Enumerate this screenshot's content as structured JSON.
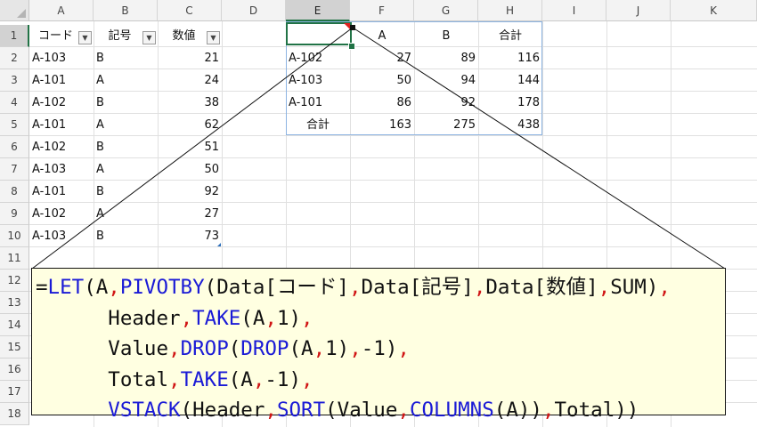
{
  "columns": [
    "A",
    "B",
    "C",
    "D",
    "E",
    "F",
    "G",
    "H",
    "I",
    "J",
    "K"
  ],
  "selected_column": "E",
  "rows": [
    "1",
    "2",
    "3",
    "4",
    "5",
    "6",
    "7",
    "8",
    "9",
    "10",
    "11",
    "12",
    "13",
    "14",
    "15",
    "16",
    "17",
    "18"
  ],
  "selected_row": "1",
  "table": {
    "headers": [
      "コード",
      "記号",
      "数値"
    ],
    "rows": [
      [
        "A-103",
        "B",
        "21"
      ],
      [
        "A-101",
        "A",
        "24"
      ],
      [
        "A-102",
        "B",
        "38"
      ],
      [
        "A-101",
        "A",
        "62"
      ],
      [
        "A-102",
        "B",
        "51"
      ],
      [
        "A-103",
        "A",
        "50"
      ],
      [
        "A-101",
        "B",
        "92"
      ],
      [
        "A-102",
        "A",
        "27"
      ],
      [
        "A-103",
        "B",
        "73"
      ]
    ]
  },
  "pivot": {
    "header": [
      "",
      "A",
      "B",
      "合計"
    ],
    "rows": [
      [
        "A-102",
        "27",
        "89",
        "116"
      ],
      [
        "A-103",
        "50",
        "94",
        "144"
      ],
      [
        "A-101",
        "86",
        "92",
        "178"
      ],
      [
        "合計",
        "163",
        "275",
        "438"
      ]
    ]
  },
  "formula": {
    "lines": [
      [
        [
          "n",
          "="
        ],
        [
          "f",
          "LET"
        ],
        [
          "n",
          "(A"
        ],
        [
          "c",
          ","
        ],
        [
          "f",
          "PIVOTBY"
        ],
        [
          "n",
          "(Data[コード]"
        ],
        [
          "c",
          ","
        ],
        [
          "n",
          "Data[記号]"
        ],
        [
          "c",
          ","
        ],
        [
          "n",
          "Data[数値]"
        ],
        [
          "c",
          ","
        ],
        [
          "n",
          "SUM)"
        ],
        [
          "c",
          ","
        ]
      ],
      [
        [
          "n",
          "      Header"
        ],
        [
          "c",
          ","
        ],
        [
          "f",
          "TAKE"
        ],
        [
          "n",
          "(A"
        ],
        [
          "c",
          ","
        ],
        [
          "n",
          "1)"
        ],
        [
          "c",
          ","
        ]
      ],
      [
        [
          "n",
          "      Value"
        ],
        [
          "c",
          ","
        ],
        [
          "f",
          "DROP"
        ],
        [
          "n",
          "("
        ],
        [
          "f",
          "DROP"
        ],
        [
          "n",
          "(A"
        ],
        [
          "c",
          ","
        ],
        [
          "n",
          "1)"
        ],
        [
          "c",
          ","
        ],
        [
          "n",
          "-1)"
        ],
        [
          "c",
          ","
        ]
      ],
      [
        [
          "n",
          "      Total"
        ],
        [
          "c",
          ","
        ],
        [
          "f",
          "TAKE"
        ],
        [
          "n",
          "(A"
        ],
        [
          "c",
          ","
        ],
        [
          "n",
          "-1)"
        ],
        [
          "c",
          ","
        ]
      ],
      [
        [
          "n",
          "      "
        ],
        [
          "f",
          "VSTACK"
        ],
        [
          "n",
          "(Header"
        ],
        [
          "c",
          ","
        ],
        [
          "f",
          "SORT"
        ],
        [
          "n",
          "(Value"
        ],
        [
          "c",
          ","
        ],
        [
          "f",
          "COLUMNS"
        ],
        [
          "n",
          "(A))"
        ],
        [
          "c",
          ","
        ],
        [
          "n",
          "Total))"
        ]
      ]
    ]
  },
  "colors": {
    "function": "#1a1ad6",
    "comma": "#d01414",
    "selection": "#217346",
    "callout_bg": "#ffffe1",
    "pivot_border": "#8db4e2"
  },
  "icons": [
    "filter-dropdown-icon",
    "error-indicator-icon",
    "fill-handle-icon"
  ]
}
